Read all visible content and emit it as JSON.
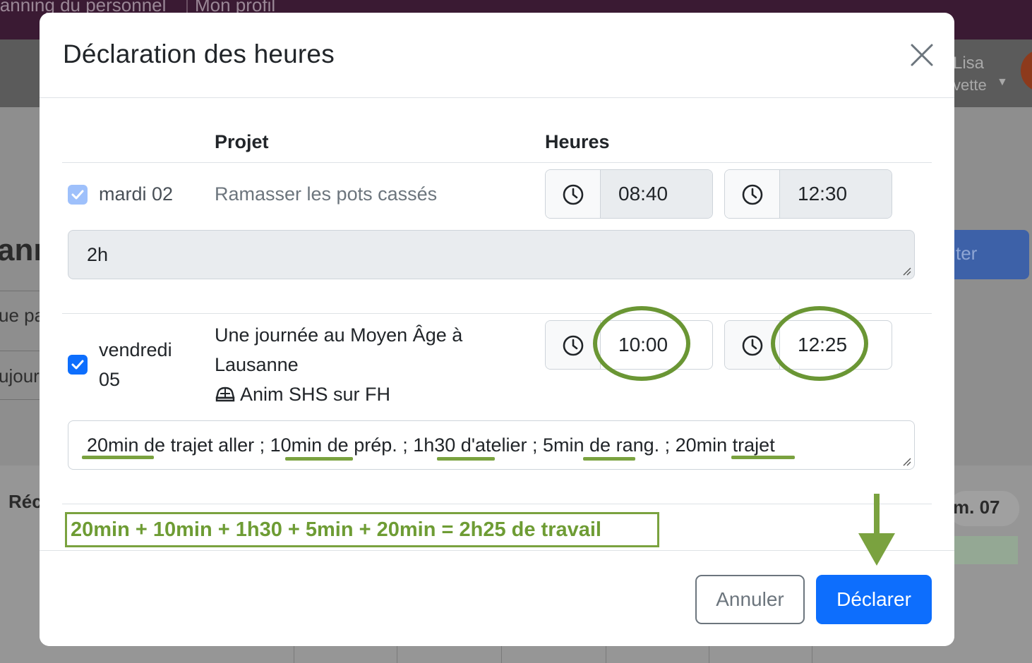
{
  "background": {
    "top_tabs": [
      "lanning du personnel",
      "Mon profil"
    ],
    "user_first": "Lisa",
    "user_last": "vette",
    "heading": "ann",
    "tab_text_1": "ue pa",
    "tab_text_2": "ujour",
    "section_title": "Réc",
    "right_button": "ter",
    "date_badge": "m. 07"
  },
  "modal": {
    "title": "Déclaration des heures",
    "columns": {
      "project": "Projet",
      "hours": "Heures"
    },
    "rows": [
      {
        "checked": true,
        "disabled": true,
        "day_line1": "mardi 02",
        "project_line1": "Ramasser les pots cassés",
        "start": "08:40",
        "end": "12:30",
        "comment": "2h"
      },
      {
        "checked": true,
        "disabled": false,
        "day_line1": "vendredi",
        "day_line2": "05",
        "project_line1": "Une journée au Moyen Âge à",
        "project_line2": "Lausanne",
        "project_tag": "Anim SHS sur FH",
        "start": "10:00",
        "end": "12:25",
        "comment": "20min de trajet aller ; 10min de prép. ; 1h30 d'atelier ; 5min de rang. ; 20min trajet"
      }
    ],
    "annotation": "20min + 10min + 1h30 + 5min + 20min = 2h25 de travail",
    "buttons": {
      "cancel": "Annuler",
      "submit": "Déclarer"
    }
  },
  "colors": {
    "primary": "#0d6efd",
    "annotation_green": "#7aa23f"
  },
  "icons": [
    "close-icon",
    "clock-icon",
    "check-icon",
    "car-icon",
    "arrow-down-icon"
  ]
}
